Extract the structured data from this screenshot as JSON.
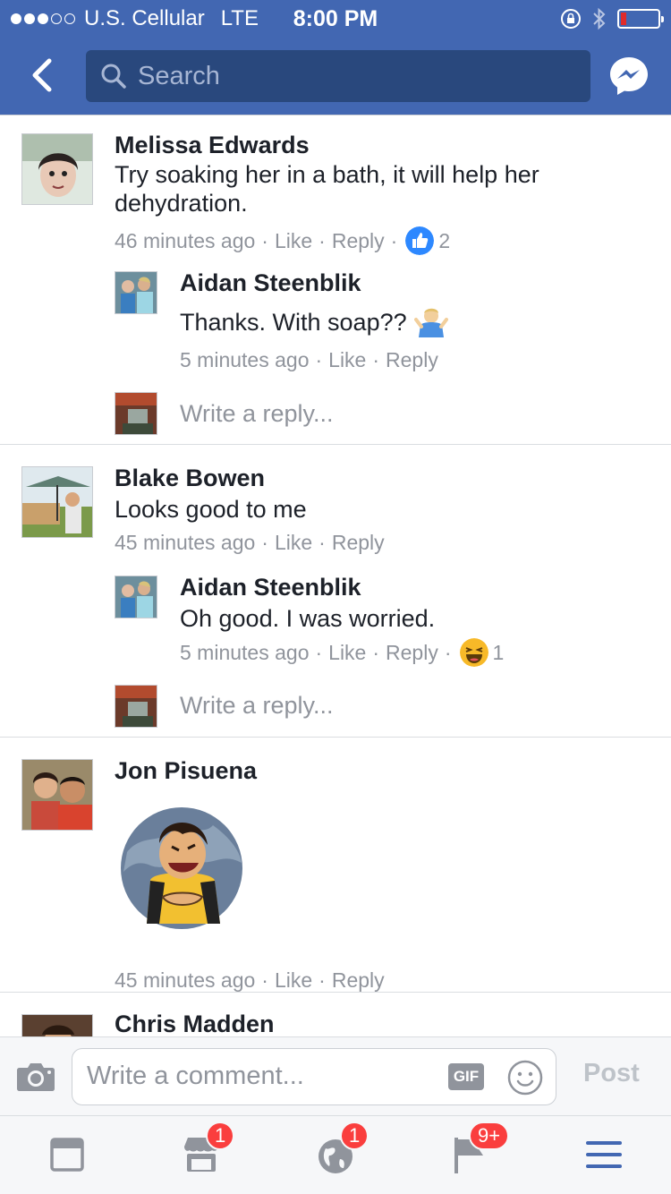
{
  "status_bar": {
    "carrier": "U.S. Cellular",
    "network": "LTE",
    "time": "8:00 PM",
    "battery_level": 0.15
  },
  "nav": {
    "search_placeholder": "Search"
  },
  "threads": [
    {
      "author": "Melissa Edwards",
      "text": "Try soaking her in a bath, it will help her dehydration.",
      "time": "46 minutes ago",
      "like": "Like",
      "reply": "Reply",
      "reaction_count": "2",
      "reaction_icon": "like-icon",
      "replies": [
        {
          "author": "Aidan Steenblik",
          "text": "Thanks. With soap??",
          "emoji_icon": "person-shrugging-icon",
          "time": "5 minutes ago",
          "like": "Like",
          "reply": "Reply"
        }
      ],
      "write_reply": "Write a reply..."
    },
    {
      "author": "Blake Bowen",
      "text": "Looks good to me",
      "time": "45 minutes ago",
      "like": "Like",
      "reply": "Reply",
      "replies": [
        {
          "author": "Aidan Steenblik",
          "text": "Oh good. I was worried.",
          "time": "5 minutes ago",
          "like": "Like",
          "reply": "Reply",
          "reaction_count": "1",
          "reaction_icon": "haha-icon"
        }
      ],
      "write_reply": "Write a reply..."
    },
    {
      "author": "Jon Pisuena",
      "sticker_icon": "laughing-man-sticker",
      "time": "45 minutes ago",
      "like": "Like",
      "reply": "Reply"
    },
    {
      "author": "Chris Madden"
    }
  ],
  "composer": {
    "placeholder": "Write a comment...",
    "gif_label": "GIF",
    "post_label": "Post"
  },
  "tab_bar": {
    "badges": {
      "marketplace": "1",
      "notifications": "1",
      "more": "9+"
    }
  },
  "colors": {
    "brand": "#4267b2",
    "badge": "#fa3e3e",
    "active_tab": "#4267b2"
  }
}
